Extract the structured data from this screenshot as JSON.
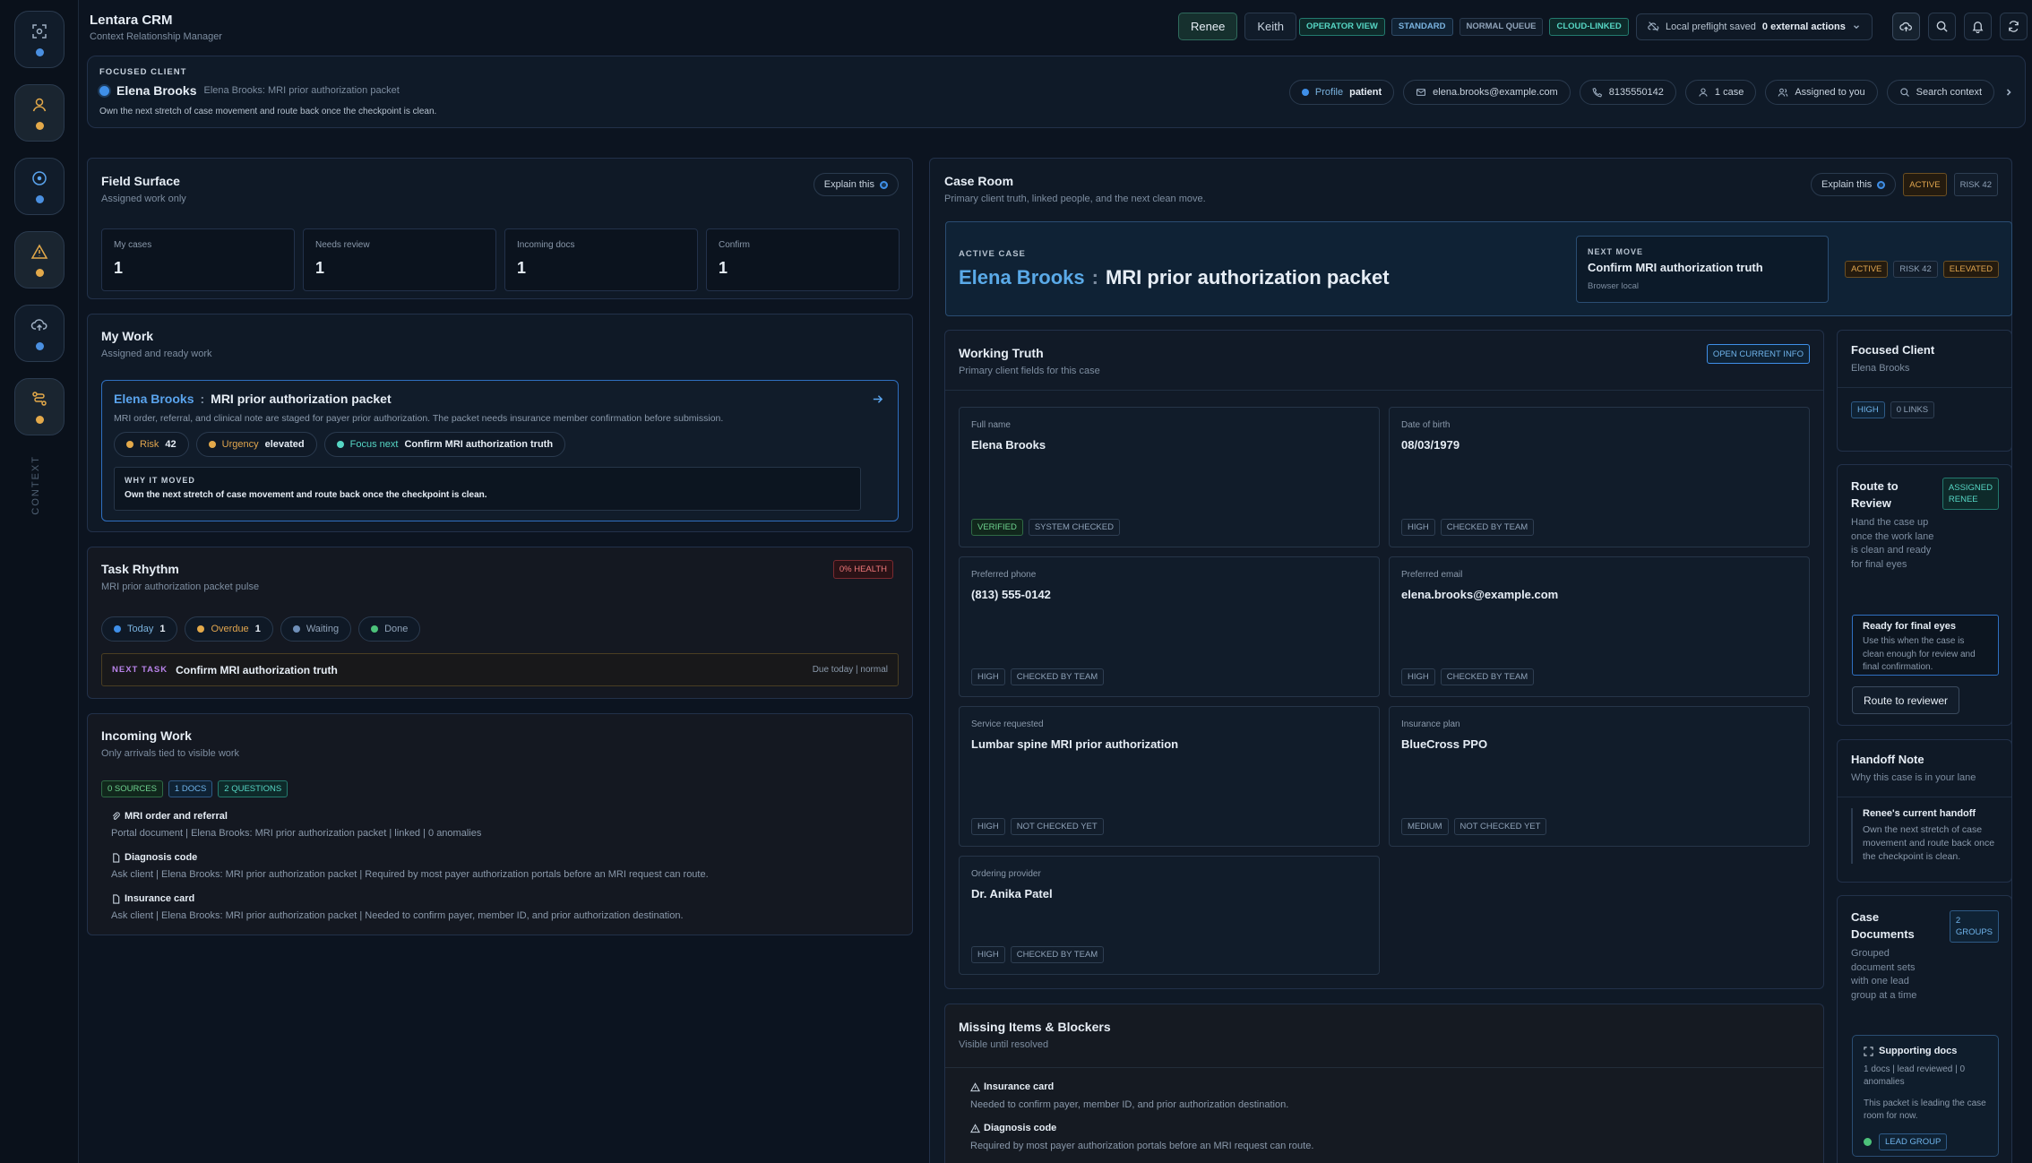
{
  "app": {
    "title": "Lentara CRM",
    "subtitle": "Context Relationship Manager"
  },
  "rail": {
    "label": "CONTEXT"
  },
  "topbar": {
    "users": [
      "Renee",
      "Keith"
    ],
    "chips": [
      "OPERATOR VIEW",
      "STANDARD",
      "NORMAL QUEUE",
      "CLOUD-LINKED"
    ],
    "preflight_text": "Local preflight saved",
    "preflight_bold": "0 external actions"
  },
  "focused": {
    "label": "FOCUSED CLIENT",
    "name": "Elena Brooks",
    "case": "Elena Brooks: MRI prior authorization packet",
    "desc": "Own the next stretch of case movement and route back once the checkpoint is clean.",
    "profile_label": "Profile",
    "profile_value": "patient",
    "email": "elena.brooks@example.com",
    "phone": "8135550142",
    "cases": "1 case",
    "assigned": "Assigned to you",
    "search": "Search context"
  },
  "field_surface": {
    "title": "Field Surface",
    "subtitle": "Assigned work only",
    "explain": "Explain this",
    "stats": [
      {
        "label": "My cases",
        "value": "1"
      },
      {
        "label": "Needs review",
        "value": "1"
      },
      {
        "label": "Incoming docs",
        "value": "1"
      },
      {
        "label": "Confirm",
        "value": "1"
      }
    ]
  },
  "my_work": {
    "title": "My Work",
    "subtitle": "Assigned and ready work",
    "card": {
      "client": "Elena Brooks",
      "sep": ":",
      "case": "MRI prior authorization packet",
      "desc": "MRI order, referral, and clinical note are staged for payer prior authorization. The packet needs insurance member confirmation before submission.",
      "risk_label": "Risk",
      "risk_value": "42",
      "urgency_label": "Urgency",
      "urgency_value": "elevated",
      "focus_label": "Focus next",
      "focus_value": "Confirm MRI authorization truth",
      "why_label": "WHY IT MOVED",
      "why_text": "Own the next stretch of case movement and route back once the checkpoint is clean."
    }
  },
  "task_rhythm": {
    "title": "Task Rhythm",
    "subtitle": "MRI prior authorization packet pulse",
    "health": "0% HEALTH",
    "pills": [
      {
        "label": "Today",
        "count": "1"
      },
      {
        "label": "Overdue",
        "count": "1"
      },
      {
        "label": "Waiting",
        "count": ""
      },
      {
        "label": "Done",
        "count": ""
      }
    ],
    "next_label": "NEXT TASK",
    "next_task": "Confirm MRI authorization truth",
    "next_due": "Due today | normal"
  },
  "incoming": {
    "title": "Incoming Work",
    "subtitle": "Only arrivals tied to visible work",
    "tags": [
      "0 SOURCES",
      "1 DOCS",
      "2 QUESTIONS"
    ],
    "items": [
      {
        "name": "MRI order and referral",
        "detail": "Portal document | Elena Brooks: MRI prior authorization packet | linked | 0 anomalies"
      },
      {
        "name": "Diagnosis code",
        "detail": "Ask client | Elena Brooks: MRI prior authorization packet | Required by most payer authorization portals before an MRI request can route."
      },
      {
        "name": "Insurance card",
        "detail": "Ask client | Elena Brooks: MRI prior authorization packet | Needed to confirm payer, member ID, and prior authorization destination."
      }
    ]
  },
  "case_room": {
    "title": "Case Room",
    "subtitle": "Primary client truth, linked people, and the next clean move.",
    "explain": "Explain this",
    "status": "ACTIVE",
    "risk": "RISK 42",
    "active_label": "ACTIVE CASE",
    "client": "Elena Brooks",
    "sep": ":",
    "case": "MRI prior authorization packet",
    "next_label": "NEXT MOVE",
    "next_move": "Confirm MRI authorization truth",
    "next_sub": "Browser local",
    "tags": [
      "ACTIVE",
      "RISK 42",
      "ELEVATED"
    ]
  },
  "working_truth": {
    "title": "Working Truth",
    "subtitle": "Primary client fields for this case",
    "open_btn": "OPEN CURRENT INFO",
    "fields": [
      {
        "label": "Full name",
        "value": "Elena Brooks",
        "tags": [
          "VERIFIED",
          "SYSTEM CHECKED"
        ]
      },
      {
        "label": "Date of birth",
        "value": "08/03/1979",
        "tags": [
          "HIGH",
          "CHECKED BY TEAM"
        ]
      },
      {
        "label": "Preferred phone",
        "value": "(813) 555-0142",
        "tags": [
          "HIGH",
          "CHECKED BY TEAM"
        ]
      },
      {
        "label": "Preferred email",
        "value": "elena.brooks@example.com",
        "tags": [
          "HIGH",
          "CHECKED BY TEAM"
        ]
      },
      {
        "label": "Service requested",
        "value": "Lumbar spine MRI prior authorization",
        "tags": [
          "HIGH",
          "NOT CHECKED YET"
        ]
      },
      {
        "label": "Insurance plan",
        "value": "BlueCross PPO",
        "tags": [
          "MEDIUM",
          "NOT CHECKED YET"
        ]
      },
      {
        "label": "Ordering provider",
        "value": "Dr. Anika Patel",
        "tags": [
          "HIGH",
          "CHECKED BY TEAM"
        ]
      }
    ]
  },
  "missing": {
    "title": "Missing Items & Blockers",
    "subtitle": "Visible until resolved",
    "items": [
      {
        "name": "Insurance card",
        "detail": "Needed to confirm payer, member ID, and prior authorization destination."
      },
      {
        "name": "Diagnosis code",
        "detail": "Required by most payer authorization portals before an MRI request can route."
      }
    ]
  },
  "right": {
    "focused_title": "Focused Client",
    "focused_name": "Elena Brooks",
    "focused_tags": [
      "HIGH",
      "0 LINKS"
    ],
    "route_title": "Route to Review",
    "route_badge_1": "ASSIGNED",
    "route_badge_2": "RENEE",
    "route_desc": "Hand the case up once the work lane is clean and ready for final eyes",
    "ready_title": "Ready for final eyes",
    "ready_desc": "Use this when the case is clean enough for review and final confirmation.",
    "route_btn": "Route to reviewer",
    "handoff_title": "Handoff Note",
    "handoff_sub": "Why this case is in your lane",
    "handoff_heading": "Renee's current handoff",
    "handoff_text": "Own the next stretch of case movement and route back once the checkpoint is clean.",
    "docs_title": "Case Documents",
    "docs_badge_1": "2",
    "docs_badge_2": "GROUPS",
    "docs_desc": "Grouped document sets with one lead group at a time",
    "support_title": "Supporting docs",
    "support_meta": "1 docs | lead reviewed | 0 anomalies",
    "support_desc": "This packet is leading the case room for now.",
    "lead_tag": "LEAD GROUP"
  }
}
